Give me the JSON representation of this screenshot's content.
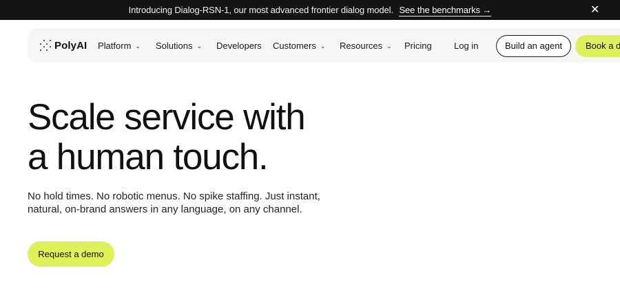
{
  "announcement": {
    "text": "Introducing Dialog-RSN-1, our most advanced frontier dialog model.",
    "link": "See the benchmarks →",
    "close": "✕"
  },
  "nav": {
    "logo": "PolyAI",
    "items": [
      {
        "label": "Platform"
      },
      {
        "label": "Solutions"
      },
      {
        "label": "Developers"
      },
      {
        "label": "Customers"
      },
      {
        "label": "Resources"
      },
      {
        "label": "Pricing"
      },
      {
        "label": "Log in"
      }
    ],
    "dropdown_chevron": "⌄",
    "build_agent": "Build an agent",
    "book_demo": "Book a demo"
  },
  "hero": {
    "title_line1": "Scale service with",
    "title_line2": "a human touch.",
    "subtitle": "No hold times. No robotic menus. No spike staffing. Just instant, natural, on-brand answers in any language, on any channel.",
    "cta": "Request a demo"
  },
  "colors": {
    "accent": "#dff05a",
    "topbar": "#141414",
    "nav_bg": "#f6f6f4"
  }
}
